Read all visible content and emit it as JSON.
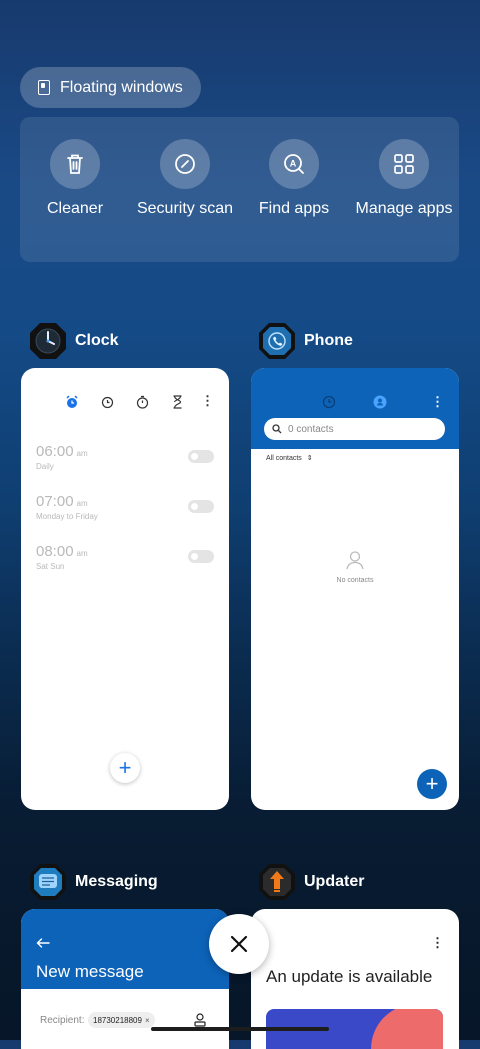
{
  "floating": {
    "label": "Floating windows"
  },
  "tools": [
    {
      "label": "Cleaner",
      "icon": "trash-icon"
    },
    {
      "label": "Security scan",
      "icon": "security-scan-icon"
    },
    {
      "label": "Find apps",
      "icon": "find-apps-icon"
    },
    {
      "label": "Manage apps",
      "icon": "grid-icon"
    }
  ],
  "apps": {
    "clock": {
      "name": "Clock",
      "alarms": [
        {
          "time": "06:00",
          "ampm": "am",
          "repeat": "Daily"
        },
        {
          "time": "07:00",
          "ampm": "am",
          "repeat": "Monday to Friday"
        },
        {
          "time": "08:00",
          "ampm": "am",
          "repeat": "Sat Sun"
        }
      ]
    },
    "phone": {
      "name": "Phone",
      "search_placeholder": "0 contacts",
      "filter": "All contacts",
      "empty": "No contacts"
    },
    "messaging": {
      "name": "Messaging",
      "title": "New message",
      "recipient_label": "Recipient:",
      "recipient_value": "18730218809",
      "chip_remove": "×"
    },
    "updater": {
      "name": "Updater",
      "title": "An update is available"
    }
  },
  "colors": {
    "accent": "#1565c0",
    "phone_header": "#0d63b8"
  }
}
